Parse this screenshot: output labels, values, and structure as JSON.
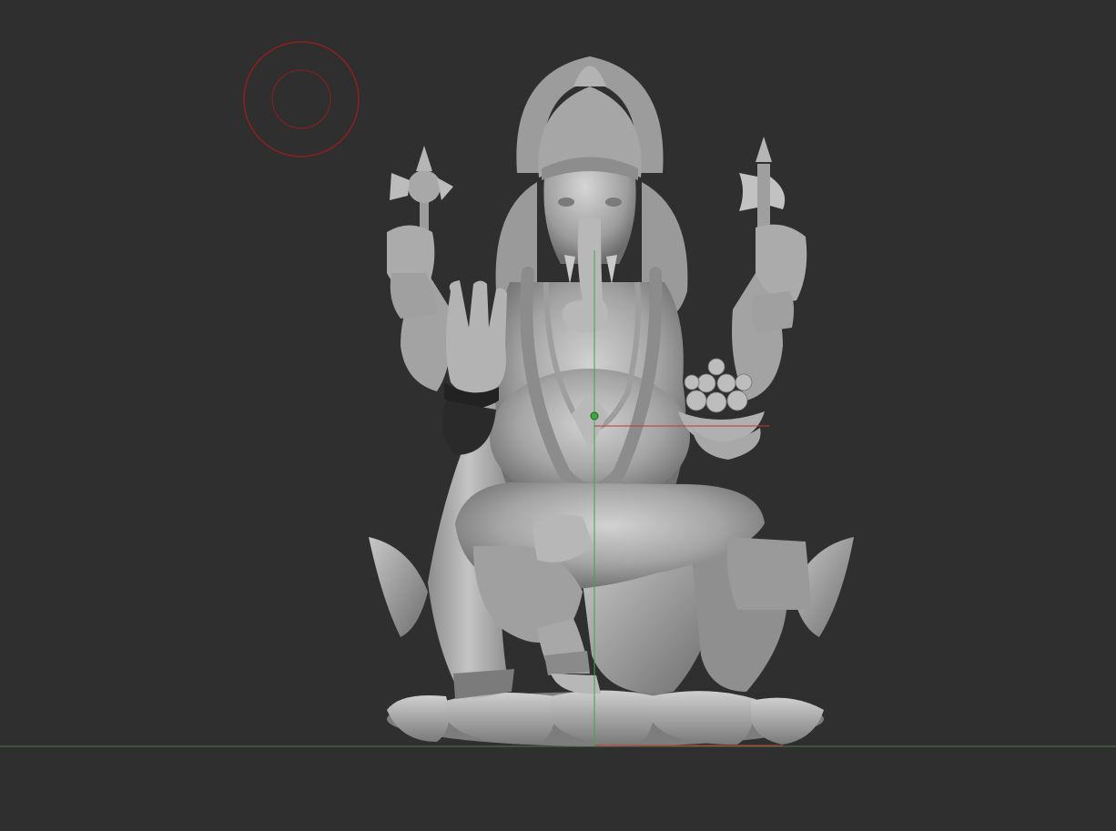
{
  "viewport": {
    "background": "#2f2f2f",
    "model_color": "#a9a9a9",
    "ground_line_color": "#4e7a4e",
    "axis_y_color": "#3fa83f",
    "axis_x_color": "#c0392b",
    "brush_cursor_color": "#8e1f1f"
  },
  "icons": {
    "brush_cursor": "brush-cursor-icon",
    "gizmo": "gizmo-pivot-icon"
  }
}
